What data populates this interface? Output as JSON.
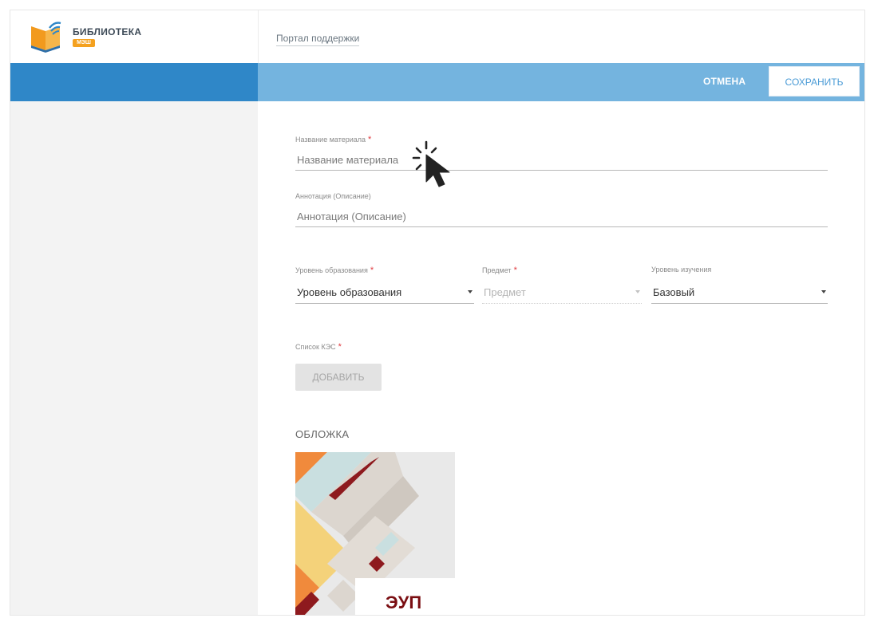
{
  "header": {
    "brand_title": "БИБЛИОТЕКА",
    "brand_subtitle": "МЭШ",
    "support_link": "Портал поддержки"
  },
  "toolbar": {
    "cancel_label": "ОТМЕНА",
    "save_label": "СОХРАНИТЬ"
  },
  "form": {
    "title_label": "Название материала",
    "title_placeholder": "Название материала",
    "annotation_label": "Аннотация (Описание)",
    "annotation_placeholder": "Аннотация (Описание)",
    "education_level_label": "Уровень образования",
    "education_level_value": "Уровень образования",
    "subject_label": "Предмет",
    "subject_value": "Предмет",
    "study_level_label": "Уровень изучения",
    "study_level_value": "Базовый",
    "kes_label": "Список КЭС",
    "add_label": "ДОБАВИТЬ",
    "required_mark": "*"
  },
  "cover": {
    "heading": "ОБЛОЖКА",
    "code": "ЭУП"
  },
  "colors": {
    "band_dark": "#2f87c8",
    "band_light": "#74b4df",
    "required": "#e0393e",
    "cover_red": "#7a0e12",
    "brand_orange": "#f4a11f"
  }
}
